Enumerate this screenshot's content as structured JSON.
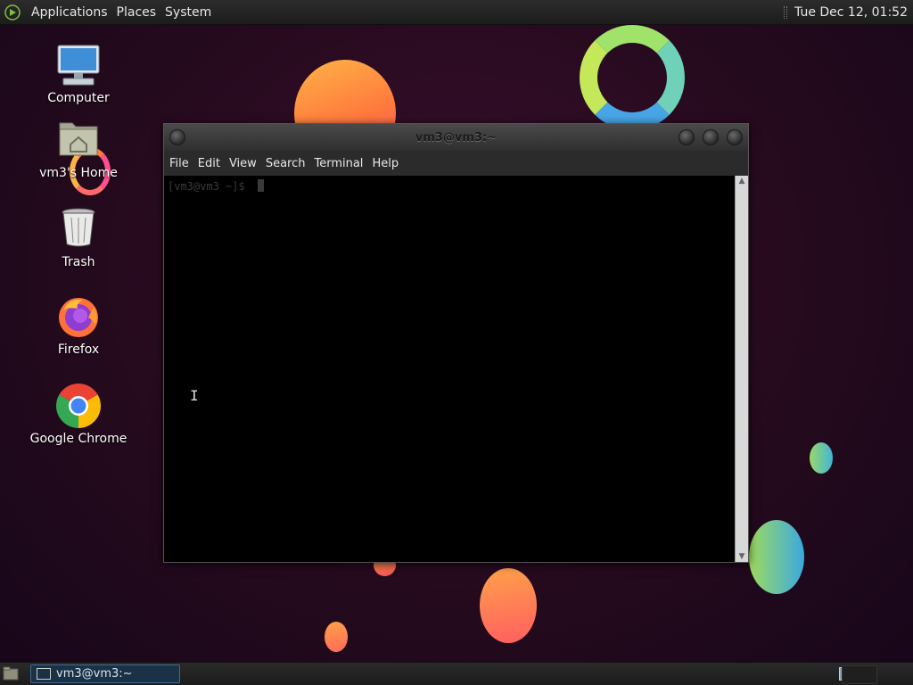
{
  "top_panel": {
    "menus": [
      "Applications",
      "Places",
      "System"
    ],
    "clock": "Tue Dec 12, 01:52"
  },
  "desktop": {
    "icons": [
      {
        "label": "Computer",
        "icon": "computer-icon"
      },
      {
        "label": "vm3's Home",
        "icon": "home-folder-icon"
      },
      {
        "label": "Trash",
        "icon": "trash-icon"
      },
      {
        "label": "Firefox",
        "icon": "firefox-icon"
      },
      {
        "label": "Google Chrome",
        "icon": "chrome-icon"
      }
    ]
  },
  "terminal": {
    "title": "vm3@vm3:~",
    "menus": [
      "File",
      "Edit",
      "View",
      "Search",
      "Terminal",
      "Help"
    ],
    "prompt": "[vm3@vm3 ~]$"
  },
  "taskbar": {
    "task_label": "vm3@vm3:~"
  },
  "colors": {
    "background": "#250a1d",
    "panel": "#1c1c1c",
    "task_active": "#1b3146"
  }
}
